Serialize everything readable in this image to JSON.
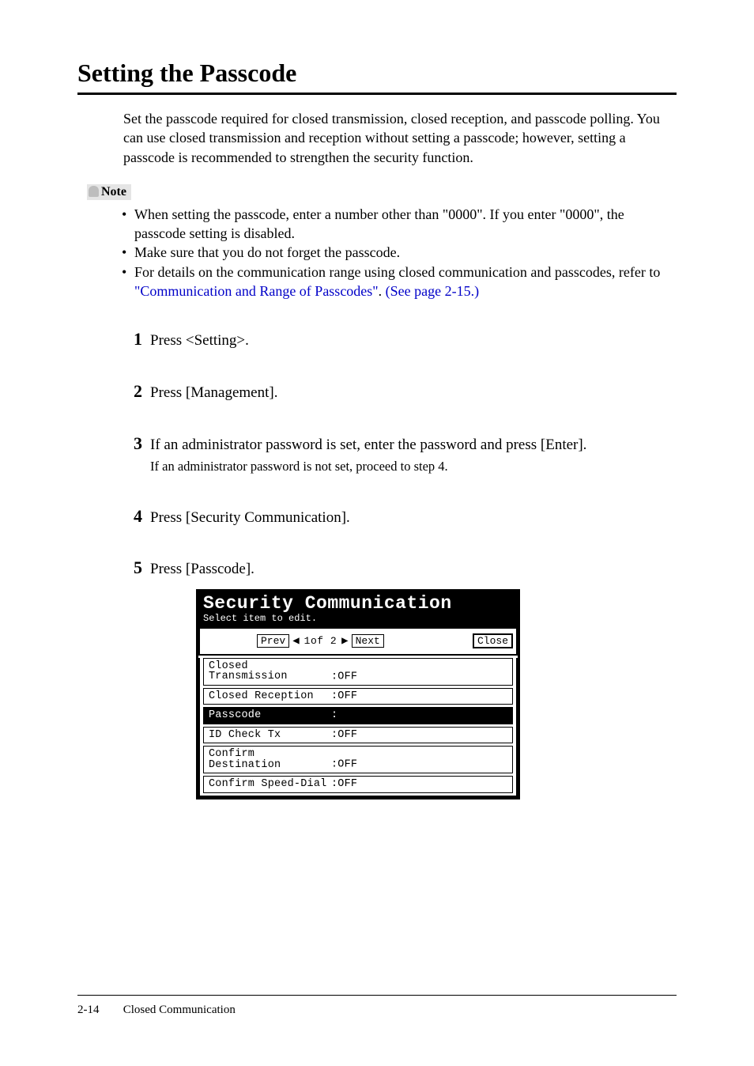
{
  "heading": "Setting the Passcode",
  "intro": "Set the passcode required for closed transmission, closed reception, and passcode polling. You can use closed transmission and reception without setting a passcode; however, setting a passcode is recommended to strengthen the security function.",
  "note_label": "Note",
  "notes": {
    "n1a": "When setting the passcode, enter a number other than \"0000\". If you enter \"0000\", the passcode setting is disabled.",
    "n2": "Make sure that you do not forget the passcode.",
    "n3_pre": "For details on the communication range using closed communication and passcodes, refer to ",
    "n3_link1": "\"Communication and Range of Passcodes\"",
    "n3_mid": ". ",
    "n3_link2": "(See page 2-15.)"
  },
  "steps": {
    "s1": "Press <Setting>.",
    "s2": "Press [Management].",
    "s3": "If an administrator password is set, enter the password and press [Enter].",
    "s3_sub": "If an administrator password is not set, proceed to step 4.",
    "s4": "Press [Security Communication].",
    "s5": "Press [Passcode]."
  },
  "lcd": {
    "title": "Security Communication",
    "subtitle": "Select item to edit.",
    "prev": "Prev",
    "next": "Next",
    "page": "1of  2",
    "close": "Close",
    "items": [
      {
        "label": "Closed Transmission",
        "value": ":OFF",
        "selected": false
      },
      {
        "label": "Closed Reception",
        "value": ":OFF",
        "selected": false
      },
      {
        "label": "Passcode",
        "value": ":",
        "selected": true
      },
      {
        "label": "ID Check Tx",
        "value": ":OFF",
        "selected": false
      },
      {
        "label": "Confirm Destination",
        "value": ":OFF",
        "selected": false
      },
      {
        "label": "Confirm Speed-Dial",
        "value": ":OFF",
        "selected": false
      }
    ]
  },
  "footer": {
    "pgnum": "2-14",
    "section": "Closed Communication"
  }
}
